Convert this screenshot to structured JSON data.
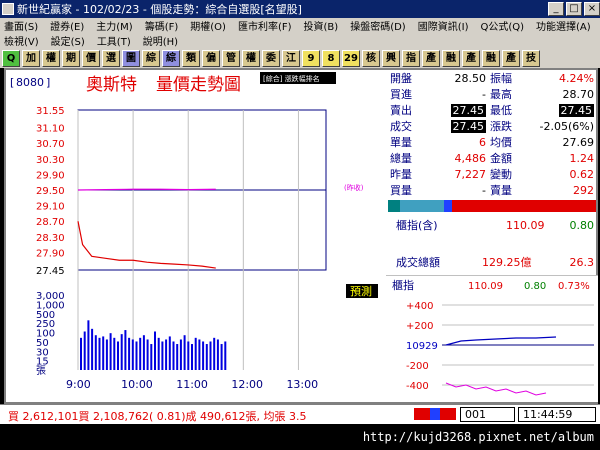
{
  "window": {
    "title": "新世紀贏家 - 102/02/23 - 個股走勢：綜合自選股[名望股]"
  },
  "menu": {
    "row1": [
      "畫面(S)",
      "證券(E)",
      "主力(M)",
      "籌碼(F)",
      "期權(O)",
      "匯市利率(F)",
      "投資(B)",
      "操盤密碼(D)",
      "國際資訊(I)",
      "Q公式(Q)",
      "功能選擇(A)"
    ],
    "row2": [
      "檢視(V)",
      "設定(S)",
      "工具(T)",
      "說明(H)"
    ]
  },
  "toolbar": [
    "Q",
    "加",
    "權",
    "期",
    "價",
    "選",
    "圖",
    "綜",
    "綜",
    "類",
    "偏",
    "管",
    "權",
    "委",
    "江",
    "9",
    "8",
    "29",
    "核",
    "興",
    "指",
    "產",
    "融",
    "產",
    "融",
    "產",
    "技"
  ],
  "stock": {
    "code": "8080",
    "name": "奧斯特",
    "view_title": "量價走勢圖",
    "tag": "[綜合] 漲跌幅排名"
  },
  "quote": {
    "open_label": "開盤",
    "open": "28.50",
    "amp_label": "振幅",
    "amp": "4.24%",
    "bid_label": "買進",
    "bid": "-",
    "high_label": "最高",
    "high": "28.70",
    "ask_label": "賣出",
    "ask": "27.45",
    "low_label": "最低",
    "low": "27.45",
    "last_label": "成交",
    "last": "27.45",
    "chg_label": "漲跌",
    "chg": "-2.05(6%)",
    "vol_label": "單量",
    "vol": "6",
    "avg_label": "均價",
    "avg": "27.69",
    "tot_label": "總量",
    "tot": "4,486",
    "amt_label": "金額",
    "amt": "1.24",
    "yvol_label": "昨量",
    "yvol": "7,227",
    "turn_label": "變動",
    "turn": "0.62",
    "bvol_label": "買量",
    "bvol": "-",
    "svol_label": "賣量",
    "svol": "292"
  },
  "index": {
    "label": "櫃指(含)",
    "value": "110.09",
    "change": "0.80",
    "turnover_label": "成交總額",
    "turnover": "129.25億",
    "turnover2": "26.3"
  },
  "mini": {
    "label": "櫃指",
    "value": "110.09",
    "chg": "0.80",
    "pct": "0.73%",
    "ticks": [
      "+400",
      "+200",
      "10929",
      "-200",
      "-400"
    ]
  },
  "chart_data": [
    {
      "type": "line",
      "title": "量價走勢圖",
      "yticks": [
        "31.55",
        "31.10",
        "30.70",
        "30.30",
        "29.90",
        "29.50",
        "29.10",
        "28.70",
        "28.30",
        "27.90",
        "27.45"
      ],
      "xticks": [
        "9:00",
        "10:00",
        "11:00",
        "12:00",
        "13:00"
      ],
      "ylim": [
        27.45,
        31.55
      ],
      "ref_label": "(昨收)",
      "series": [
        {
          "name": "",
          "x": [
            0,
            5,
            15,
            30,
            45,
            60,
            75,
            90,
            105,
            120,
            135,
            150
          ],
          "values": [
            28.7,
            28.1,
            27.8,
            27.75,
            27.7,
            27.7,
            27.65,
            27.62,
            27.6,
            27.58,
            27.55,
            27.5
          ]
        },
        {
          "name": "",
          "x": [
            0,
            30,
            60,
            90,
            120,
            150
          ],
          "values": [
            29.5,
            29.51,
            29.52,
            29.52,
            29.51,
            29.52
          ]
        }
      ]
    },
    {
      "type": "bar",
      "yticks": [
        "3,000",
        "1,000",
        "500",
        "250",
        "100",
        "50",
        "30",
        "15",
        "張"
      ],
      "values": [
        30,
        60,
        200,
        80,
        40,
        30,
        35,
        25,
        50,
        30,
        20,
        45,
        70,
        30,
        25,
        20,
        30,
        40,
        25,
        15,
        60,
        30,
        20,
        25,
        35,
        20,
        15,
        25,
        40,
        20,
        15,
        30,
        25,
        20,
        15,
        20,
        30,
        25,
        15,
        20
      ]
    }
  ],
  "buttons": {
    "predict": "預測"
  },
  "status": {
    "text": "買 2,612,101買 2,108,762( 0.81)成 490,612張, 均張 3.5",
    "code": "001",
    "time": "11:44:59"
  },
  "footer": {
    "url": "http://kujd3268.pixnet.net/album"
  }
}
